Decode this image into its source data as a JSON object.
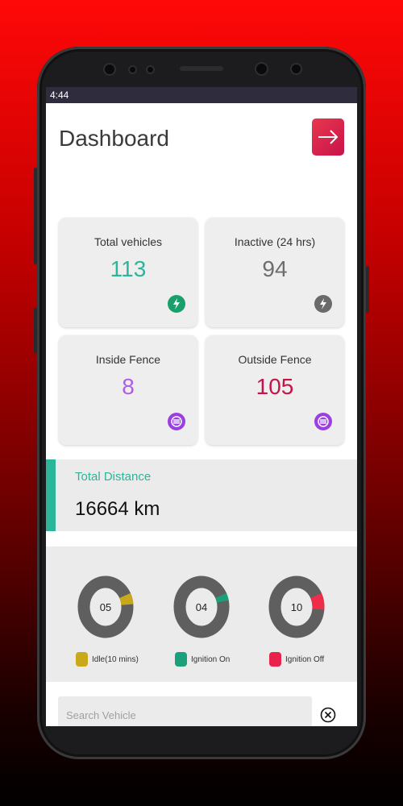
{
  "status_bar": {
    "time": "4:44"
  },
  "header": {
    "title": "Dashboard"
  },
  "cards": [
    {
      "label": "Total vehicles",
      "value": "113",
      "value_color": "#2bb59a",
      "icon": "bolt-icon",
      "icon_color": "#1a9e6a"
    },
    {
      "label": "Inactive (24 hrs)",
      "value": "94",
      "value_color": "#6d6d6d",
      "icon": "bolt-icon",
      "icon_color": "#6a6a6a"
    },
    {
      "label": "Inside Fence",
      "value": "8",
      "value_color": "#b05ce8",
      "icon": "fence-icon",
      "icon_color": "#9b3fe0"
    },
    {
      "label": "Outside Fence",
      "value": "105",
      "value_color": "#c8124a",
      "icon": "fence-icon",
      "icon_color": "#9b3fe0"
    }
  ],
  "distance": {
    "label": "Total Distance",
    "value": "16664 km"
  },
  "donuts": [
    {
      "center": "05",
      "legend": "Idle(10 mins)",
      "color": "#c9a81a",
      "fraction": 0.06
    },
    {
      "center": "04",
      "legend": "Ignition On",
      "color": "#1aa07a",
      "fraction": 0.04
    },
    {
      "center": "10",
      "legend": "Ignition Off",
      "color": "#ee2e48",
      "fraction": 0.09
    }
  ],
  "search": {
    "placeholder": "Search Vehicle"
  },
  "colors": {
    "accent": "#2bb59a",
    "donut_track": "#5f5f5f"
  }
}
